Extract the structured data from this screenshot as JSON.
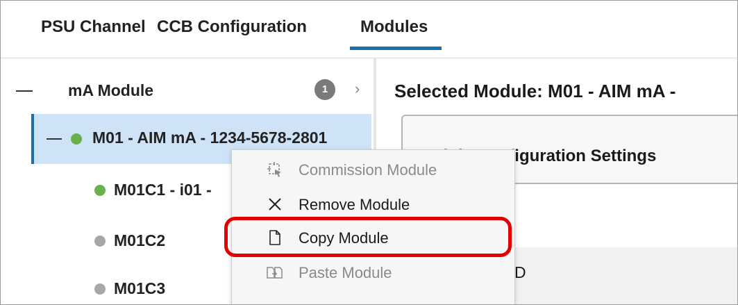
{
  "tabs": [
    {
      "label": "PSU Channel"
    },
    {
      "label": "CCB Configuration"
    },
    {
      "label": "Modules",
      "active": true
    }
  ],
  "tree": {
    "group": {
      "label": "mA Module",
      "badge": "1"
    },
    "module": {
      "label": "M01 - AIM mA - 1234-5678-2801",
      "status": "green"
    },
    "channels": [
      {
        "label": "M01C1 - i01 -",
        "status": "green"
      },
      {
        "label": "M01C2",
        "status": "gray"
      },
      {
        "label": "M01C3",
        "status": "gray"
      }
    ]
  },
  "right_panel": {
    "title": "Selected Module: M01 - AIM mA -",
    "card_title": "Module Configuration Settings",
    "field_fragment": "D"
  },
  "context_menu": {
    "items": [
      {
        "label": "Commission Module",
        "icon": "commission-icon",
        "enabled": false
      },
      {
        "label": "Remove Module",
        "icon": "close-icon",
        "enabled": true
      },
      {
        "label": "Copy Module",
        "icon": "document-icon",
        "enabled": true,
        "highlighted": true
      },
      {
        "label": "Paste Module",
        "icon": "paste-icon",
        "enabled": false
      }
    ]
  },
  "colors": {
    "accent": "#1b6fad",
    "selection": "#cfe3f6",
    "status_green": "#6ab04c",
    "status_gray": "#a8a8a8",
    "highlight_red": "#e20000"
  }
}
